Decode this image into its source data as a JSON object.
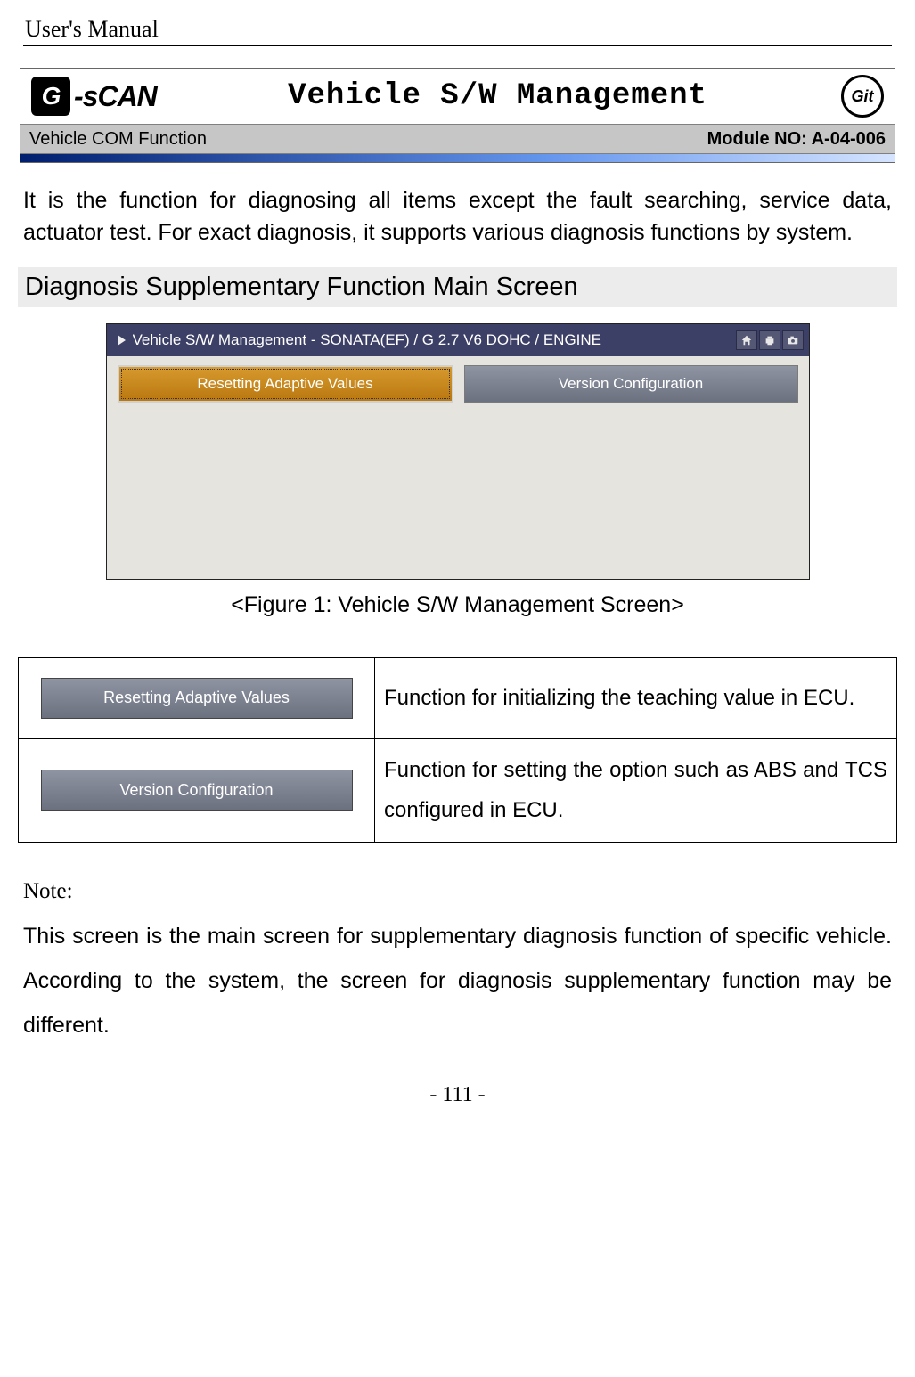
{
  "header": {
    "manual_title": "User's Manual"
  },
  "title_block": {
    "logo_g": "G",
    "logo_text": "-sCAN",
    "main_title": "Vehicle S/W Management",
    "git_text": "Git",
    "sub_left": "Vehicle COM Function",
    "sub_right": "Module NO: A-04-006"
  },
  "intro_text": "It is the function for diagnosing all items except the fault searching, service data, actuator test. For exact diagnosis, it supports various diagnosis functions by system.",
  "section_heading": "Diagnosis Supplementary Function Main Screen",
  "screenshot": {
    "titlebar": "Vehicle S/W Management - SONATA(EF) / G 2.7 V6 DOHC / ENGINE",
    "btn_selected": "Resetting Adaptive Values",
    "btn_normal": "Version Configuration"
  },
  "figure_caption": "<Figure 1: Vehicle S/W Management Screen>",
  "func_table": {
    "rows": [
      {
        "button_label": "Resetting Adaptive Values",
        "desc": "Function for initializing the teaching value in ECU."
      },
      {
        "button_label": "Version Configuration",
        "desc": "Function for setting the option such as ABS and TCS configured in ECU."
      }
    ]
  },
  "note": {
    "head": "Note:",
    "body": "This screen is the main screen for supplementary diagnosis function of specific vehicle. According to the system, the screen for diagnosis supplementary function may be different."
  },
  "footer": {
    "page_no": "- 111 -"
  }
}
